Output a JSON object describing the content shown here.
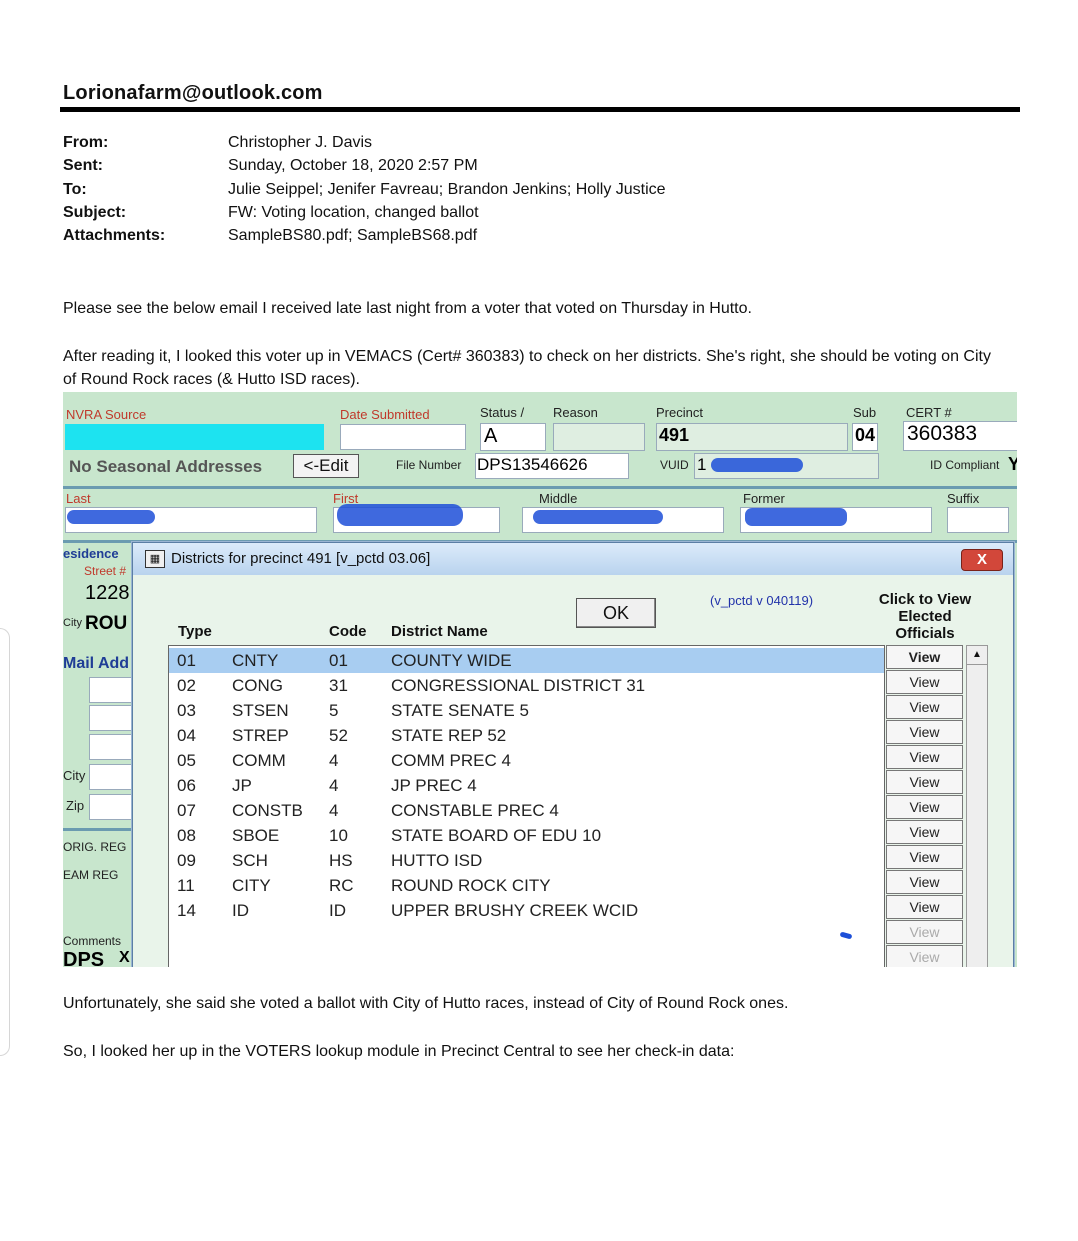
{
  "email": {
    "address": "Lorionafarm@outlook.com",
    "headers": [
      {
        "label": "From:",
        "value": "Christopher J. Davis"
      },
      {
        "label": "Sent:",
        "value": "Sunday, October 18, 2020 2:57 PM"
      },
      {
        "label": "To:",
        "value": "Julie Seippel; Jenifer Favreau; Brandon Jenkins; Holly Justice"
      },
      {
        "label": "Subject:",
        "value": "FW: Voting location, changed ballot"
      },
      {
        "label": "Attachments:",
        "value": "SampleBS80.pdf; SampleBS68.pdf"
      }
    ],
    "para1": "Please see the below email I received late last night from a voter that voted on Thursday in Hutto.",
    "para2": "After reading it, I looked this voter up in VEMACS (Cert# 360383) to check on her districts.  She's right, she should be voting on City of Round Rock races (& Hutto ISD races).",
    "para3": "Unfortunately, she said she voted a ballot with City of Hutto races, instead of City of Round Rock ones.",
    "para4": "So, I looked her up in the VOTERS lookup module in Precinct Central to see her check-in data:"
  },
  "app": {
    "nvra_source": "NVRA Source",
    "date_submitted": "Date Submitted",
    "status": "Status  /",
    "reason": "Reason",
    "status_value": "A",
    "precinct": "Precinct",
    "precinct_value": "491",
    "sub": "Sub",
    "sub_value": "04",
    "cert": "CERT #",
    "cert_value": "360383",
    "no_seasonal": "No Seasonal Addresses",
    "edit_button": "<-Edit",
    "file_number_label": "File Number",
    "file_number_value": "DPS13546626",
    "vuid_label": "VUID",
    "vuid_value": "1",
    "id_compliant": "ID Compliant",
    "id_compliant_value": "Y",
    "last": "Last",
    "first": "First",
    "middle": "Middle",
    "former": "Former",
    "suffix": "Suffix",
    "residence": "esidence",
    "street": "Street #",
    "street_value": "1228",
    "city_label": "City",
    "city_value": "ROU",
    "mail_addr": "Mail Add",
    "city2": "City",
    "zip": "Zip",
    "orig_reg": "ORIG. REG",
    "eam_reg": "EAM REG",
    "comments": "Comments",
    "dps": "DPS",
    "dps_suffix": "X"
  },
  "dialog": {
    "title": "Districts for precinct 491  [v_pctd 03.06]",
    "close_label": "X",
    "ok_label": "OK",
    "version": "(v_pctd  v 040119)",
    "click_to_view": "Click to View Elected Officials",
    "col_type": "Type",
    "col_code": "Code",
    "col_district": "District Name",
    "rows": [
      {
        "num": "01",
        "type": "CNTY",
        "code": "01",
        "name": "COUNTY WIDE"
      },
      {
        "num": "02",
        "type": "CONG",
        "code": "31",
        "name": "CONGRESSIONAL DISTRICT 31"
      },
      {
        "num": "03",
        "type": "STSEN",
        "code": "5",
        "name": "STATE SENATE 5"
      },
      {
        "num": "04",
        "type": "STREP",
        "code": "52",
        "name": "STATE REP 52"
      },
      {
        "num": "05",
        "type": "COMM",
        "code": "4",
        "name": "COMM PREC 4"
      },
      {
        "num": "06",
        "type": "JP",
        "code": "4",
        "name": "JP PREC 4"
      },
      {
        "num": "07",
        "type": "CONSTB",
        "code": "4",
        "name": "CONSTABLE PREC 4"
      },
      {
        "num": "08",
        "type": "SBOE",
        "code": "10",
        "name": "STATE BOARD OF EDU 10"
      },
      {
        "num": "09",
        "type": "SCH",
        "code": "HS",
        "name": "HUTTO ISD"
      },
      {
        "num": "11",
        "type": "CITY",
        "code": "RC",
        "name": "ROUND ROCK CITY"
      },
      {
        "num": "14",
        "type": "ID",
        "code": "ID",
        "name": "UPPER BRUSHY CREEK WCID"
      }
    ],
    "view_label": "View",
    "scroll_up": "▲"
  }
}
